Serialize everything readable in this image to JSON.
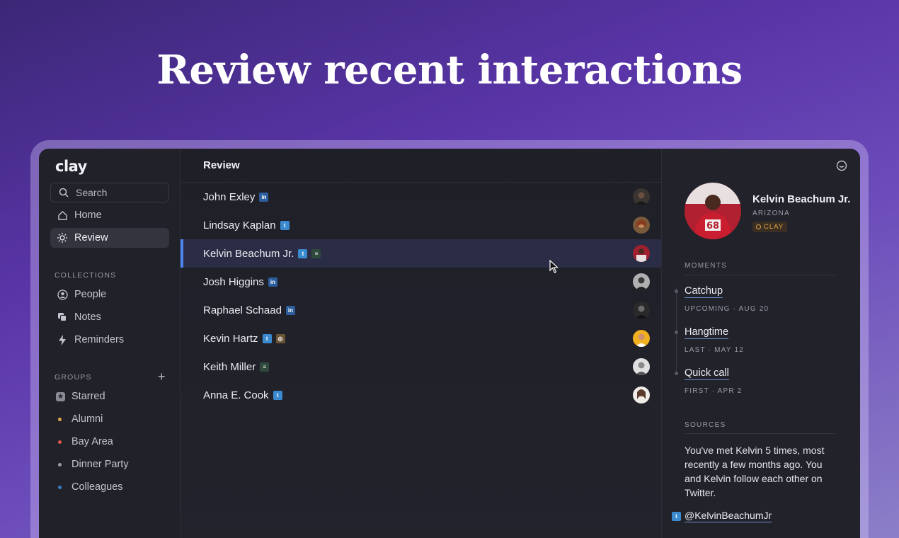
{
  "headline": "Review recent interactions",
  "sidebar": {
    "logo": "clay",
    "search_placeholder": "Search",
    "nav": [
      {
        "label": "Home",
        "icon": "home-icon"
      },
      {
        "label": "Review",
        "icon": "sun-icon",
        "active": true
      }
    ],
    "collections_label": "COLLECTIONS",
    "collections": [
      {
        "label": "People",
        "icon": "person-icon"
      },
      {
        "label": "Notes",
        "icon": "notes-icon"
      },
      {
        "label": "Reminders",
        "icon": "bolt-icon"
      }
    ],
    "groups_label": "GROUPS",
    "groups": [
      {
        "label": "Starred",
        "icon": "star-icon"
      },
      {
        "label": "Alumni",
        "color": "#e3a74a"
      },
      {
        "label": "Bay Area",
        "color": "#e0564e"
      },
      {
        "label": "Dinner Party",
        "color": "#9a9aa6"
      },
      {
        "label": "Colleagues",
        "color": "#3b7fc4"
      }
    ]
  },
  "list": {
    "title": "Review",
    "rows": [
      {
        "name": "John Exley",
        "badges": [
          "linkedin"
        ]
      },
      {
        "name": "Lindsay Kaplan",
        "badges": [
          "twitter"
        ]
      },
      {
        "name": "Kelvin Beachum Jr.",
        "badges": [
          "twitter",
          "database"
        ],
        "selected": true
      },
      {
        "name": "Josh Higgins",
        "badges": [
          "linkedin"
        ]
      },
      {
        "name": "Raphael Schaad",
        "badges": [
          "linkedin"
        ]
      },
      {
        "name": "Kevin Hartz",
        "badges": [
          "twitter",
          "instagram"
        ]
      },
      {
        "name": "Keith Miller",
        "badges": [
          "database"
        ]
      },
      {
        "name": "Anna E. Cook",
        "badges": [
          "twitter"
        ]
      }
    ]
  },
  "detail": {
    "name": "Kelvin Beachum Jr.",
    "location": "ARIZONA",
    "tag": "CLAY",
    "moments_label": "MOMENTS",
    "moments": [
      {
        "title": "Catchup",
        "sub": "UPCOMING · AUG 20"
      },
      {
        "title": "Hangtime",
        "sub": "LAST · MAY 12"
      },
      {
        "title": "Quick call",
        "sub": "FIRST · APR 2"
      }
    ],
    "sources_label": "SOURCES",
    "sources_text": "You've met Kelvin 5 times, most recently a few months ago. You and Kelvin follow each other on Twitter.",
    "twitter_handle": "@KelvinBeachumJr"
  },
  "colors": {
    "accent_blue": "#4c86f0",
    "clay_orange": "#e3a74a"
  }
}
